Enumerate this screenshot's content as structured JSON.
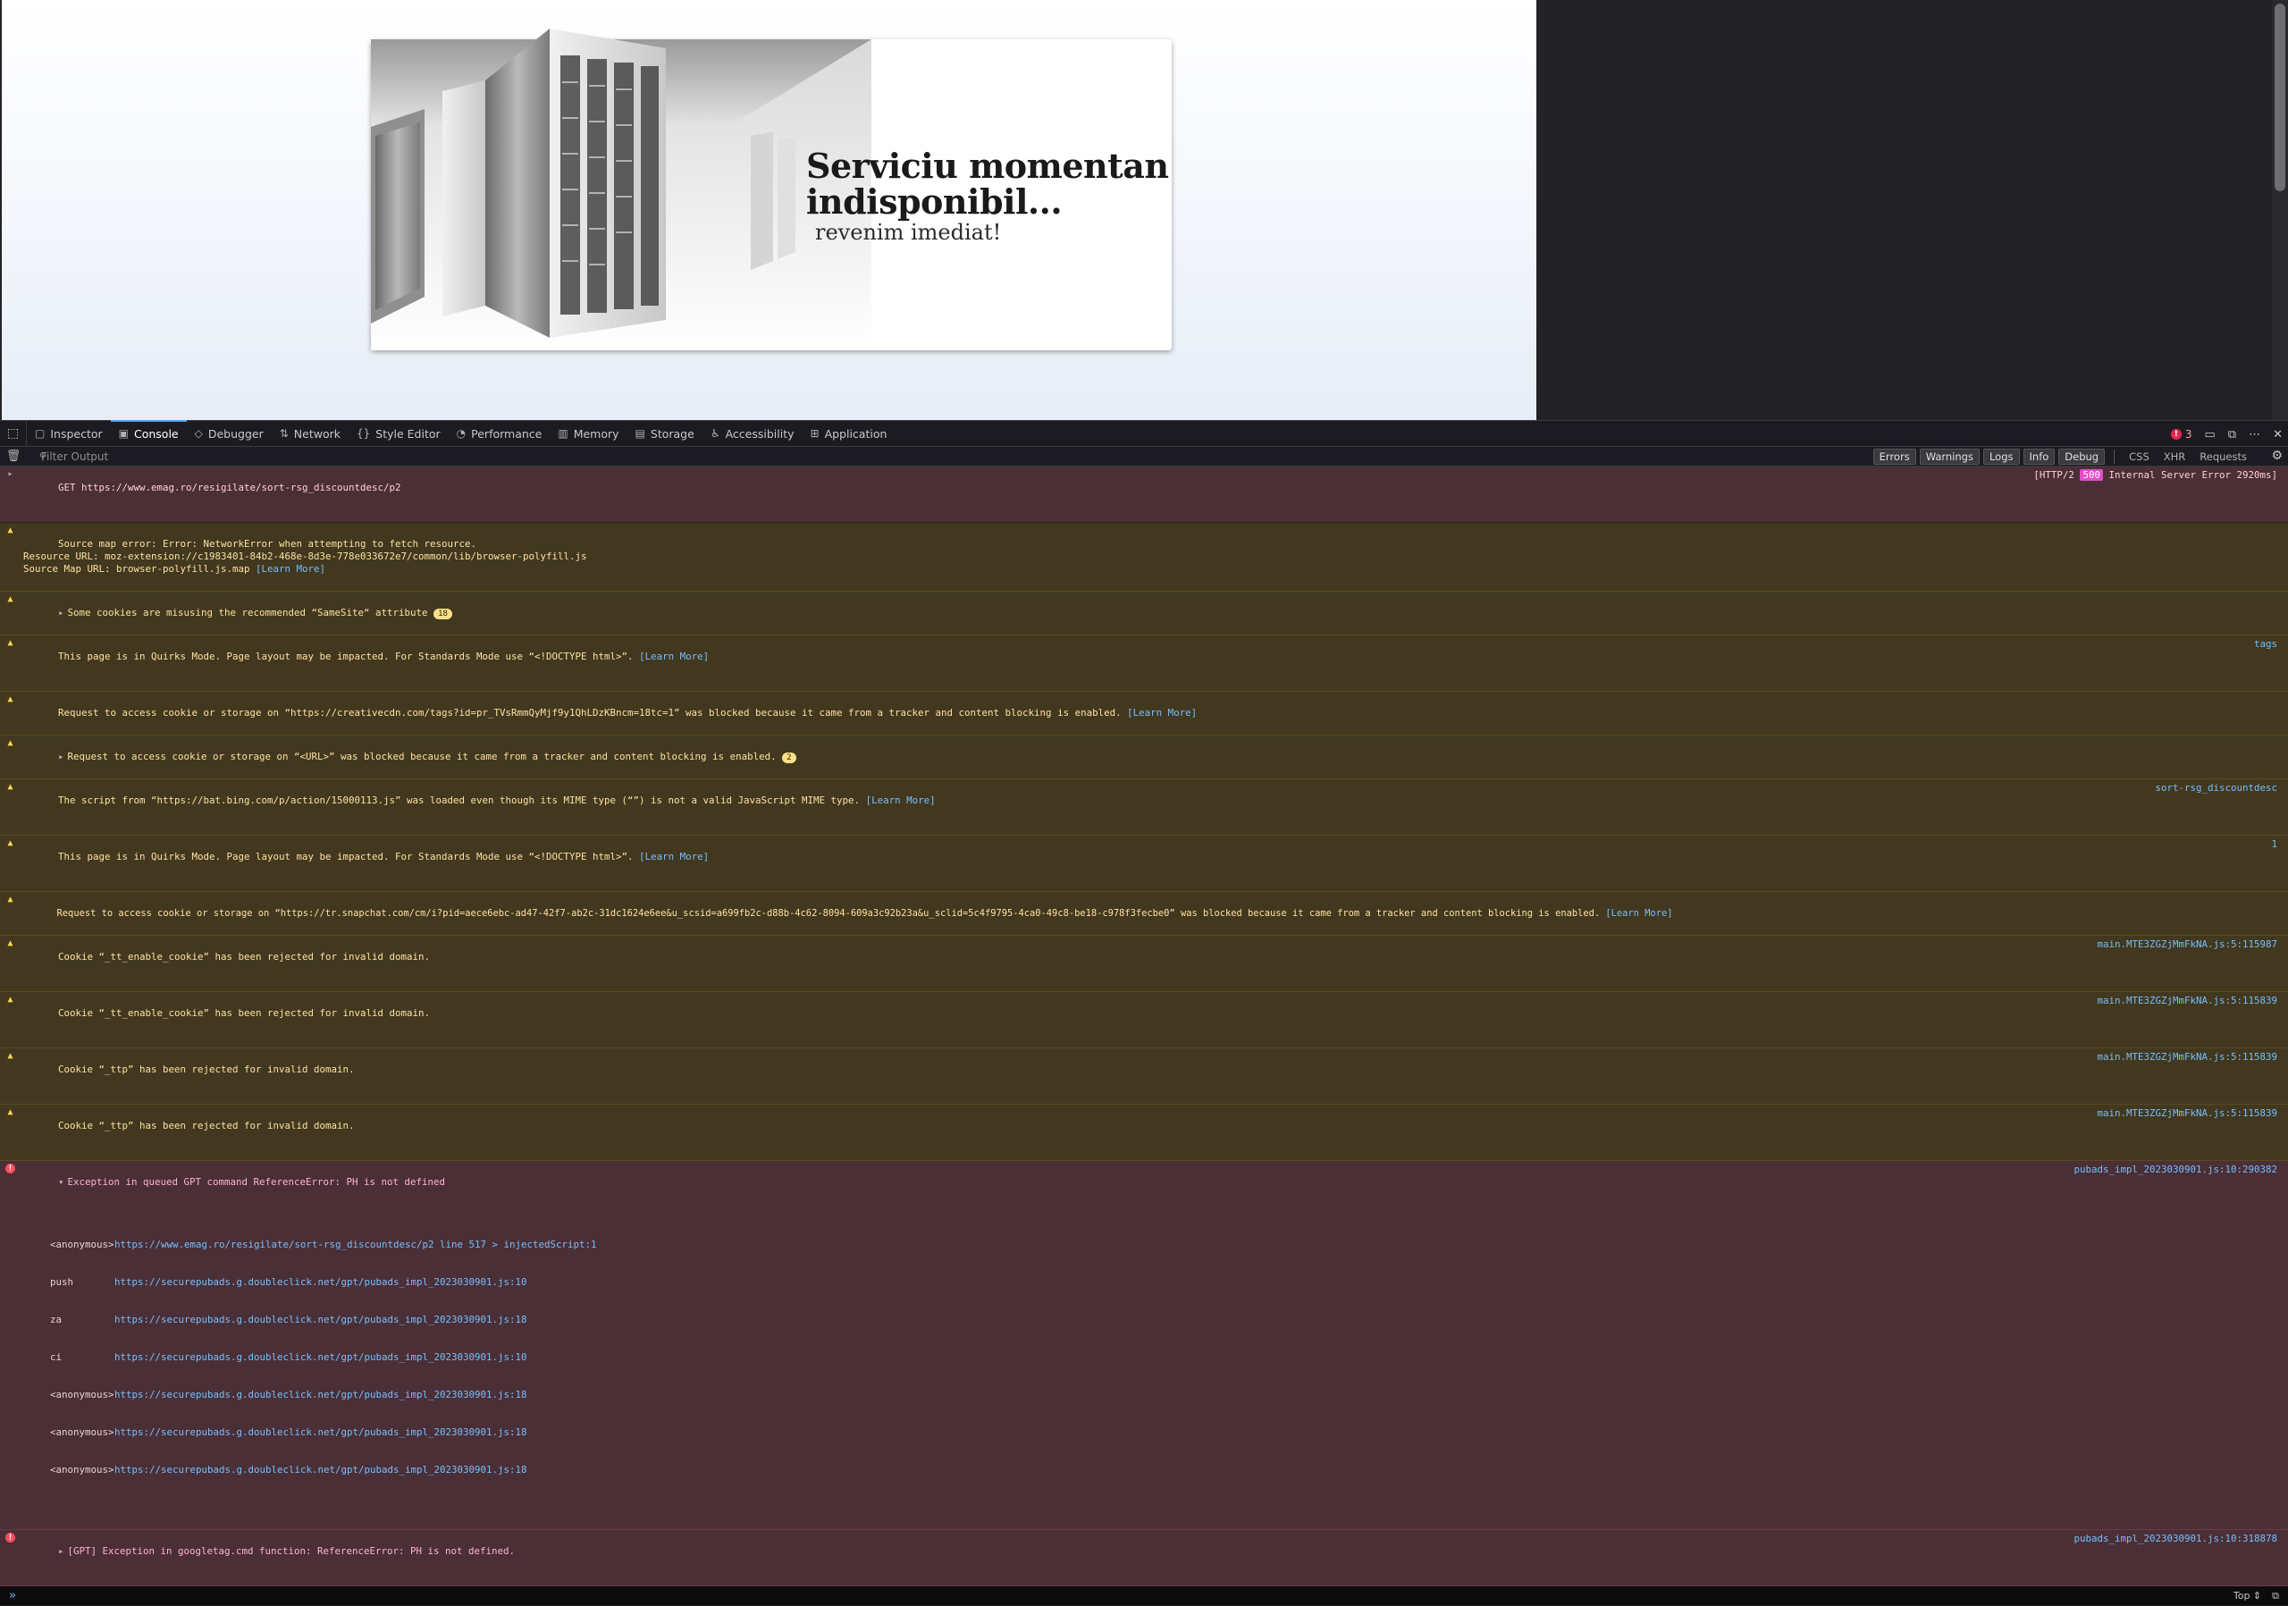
{
  "banner": {
    "title": "Serviciu momentan\n indisponibil...",
    "subtitle": "revenim imediat!"
  },
  "toolbox": {
    "tabs": [
      {
        "icon": "inspector-icon",
        "label": "Inspector"
      },
      {
        "icon": "console-icon",
        "label": "Console"
      },
      {
        "icon": "debugger-icon",
        "label": "Debugger"
      },
      {
        "icon": "network-icon",
        "label": "Network"
      },
      {
        "icon": "style-editor-icon",
        "label": "Style Editor"
      },
      {
        "icon": "performance-icon",
        "label": "Performance"
      },
      {
        "icon": "memory-icon",
        "label": "Memory"
      },
      {
        "icon": "storage-icon",
        "label": "Storage"
      },
      {
        "icon": "accessibility-icon",
        "label": "Accessibility"
      },
      {
        "icon": "application-icon",
        "label": "Application"
      }
    ],
    "active_tab": "Console",
    "error_count": "3"
  },
  "filter": {
    "placeholder": "Filter Output",
    "levels": [
      "Errors",
      "Warnings",
      "Logs",
      "Info",
      "Debug"
    ],
    "kinds": [
      "CSS",
      "XHR",
      "Requests"
    ]
  },
  "messages": {
    "m0": {
      "method": "GET",
      "url": "https://www.emag.ro/resigilate/sort-rsg_discountdesc/p2",
      "proto": "[HTTP/2",
      "status": "500",
      "status_text": "Internal Server Error 2920ms]"
    },
    "m1": {
      "line1": "Source map error: Error: NetworkError when attempting to fetch resource.",
      "line2": "Resource URL: moz-extension://c1983401-84b2-468e-8d3e-778e033672e7/common/lib/browser-polyfill.js",
      "line3": "Source Map URL: browser-polyfill.js.map",
      "learn": "[Learn More]"
    },
    "m2": {
      "text": "Some cookies are misusing the recommended “SameSite“ attribute",
      "count": "18"
    },
    "m3": {
      "text": "This page is in Quirks Mode. Page layout may be impacted. For Standards Mode use “<!DOCTYPE html>”.",
      "learn": "[Learn More]",
      "src": "tags"
    },
    "m4": {
      "text": "Request to access cookie or storage on “https://creativecdn.com/tags?id=pr_TVsRmmQyMjf9y1QhLDzKBncm=18tc=1” was blocked because it came from a tracker and content blocking is enabled.",
      "learn": "[Learn More]"
    },
    "m5": {
      "text": "Request to access cookie or storage on “<URL>” was blocked because it came from a tracker and content blocking is enabled.",
      "count": "2"
    },
    "m6": {
      "text": "The script from “https://bat.bing.com/p/action/15000113.js” was loaded even though its MIME type (“”) is not a valid JavaScript MIME type.",
      "learn": "[Learn More]",
      "src": "sort-rsg_discountdesc"
    },
    "m7": {
      "text": "This page is in Quirks Mode. Page layout may be impacted. For Standards Mode use “<!DOCTYPE html>”.",
      "learn": "[Learn More]",
      "src": "1"
    },
    "m8": {
      "text": "Request to access cookie or storage on “https://tr.snapchat.com/cm/i?pid=aece6ebc-ad47-42f7-ab2c-31dc1624e6ee&u_scsid=a699fb2c-d88b-4c62-8094-609a3c92b23a&u_sclid=5c4f9795-4ca0-49c8-be18-c978f3fecbe0” was blocked because it came from a tracker and content blocking is enabled.",
      "learn": "[Learn More]"
    },
    "m9": {
      "text": "Cookie “_tt_enable_cookie” has been rejected for invalid domain.",
      "src": "main.MTE3ZGZjMmFkNA.js:5:115987"
    },
    "m10": {
      "text": "Cookie “_tt_enable_cookie” has been rejected for invalid domain.",
      "src": "main.MTE3ZGZjMmFkNA.js:5:115839"
    },
    "m11": {
      "text": "Cookie “_ttp” has been rejected for invalid domain.",
      "src": "main.MTE3ZGZjMmFkNA.js:5:115839"
    },
    "m12": {
      "text": "Cookie “_ttp” has been rejected for invalid domain.",
      "src": "main.MTE3ZGZjMmFkNA.js:5:115839"
    },
    "m13": {
      "text": "Exception in queued GPT command ReferenceError: PH is not defined",
      "src": "pubads_impl_2023030901.js:10:290382",
      "stack": [
        {
          "fn": "<anonymous>",
          "loc": "https://www.emag.ro/resigilate/sort-rsg_discountdesc/p2 line 517 > injectedScript:1"
        },
        {
          "fn": "push",
          "loc": "https://securepubads.g.doubleclick.net/gpt/pubads_impl_2023030901.js:10"
        },
        {
          "fn": "za",
          "loc": "https://securepubads.g.doubleclick.net/gpt/pubads_impl_2023030901.js:18"
        },
        {
          "fn": "ci",
          "loc": "https://securepubads.g.doubleclick.net/gpt/pubads_impl_2023030901.js:10"
        },
        {
          "fn": "<anonymous>",
          "loc": "https://securepubads.g.doubleclick.net/gpt/pubads_impl_2023030901.js:18"
        },
        {
          "fn": "<anonymous>",
          "loc": "https://securepubads.g.doubleclick.net/gpt/pubads_impl_2023030901.js:18"
        },
        {
          "fn": "<anonymous>",
          "loc": "https://securepubads.g.doubleclick.net/gpt/pubads_impl_2023030901.js:18"
        }
      ]
    },
    "m14": {
      "text": "[GPT] Exception in googletag.cmd function: ReferenceError: PH is not defined.",
      "src": "pubads_impl_2023030901.js:10:318878"
    }
  },
  "prompt": {
    "symbol": "»",
    "context": "Top ⇕"
  },
  "colors": {
    "warning": "#42381f",
    "error": "#4b2f36",
    "link": "#75bfff",
    "accent": "#4ba6ff"
  }
}
